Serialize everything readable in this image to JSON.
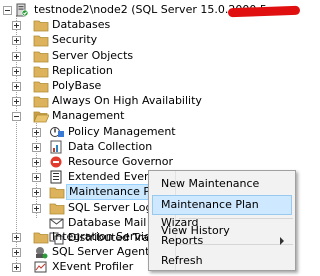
{
  "server": {
    "label": "testnode2\\node2 (SQL Server 15.0.2000.5 - "
  },
  "tree": {
    "items": [
      {
        "label": "Databases"
      },
      {
        "label": "Security"
      },
      {
        "label": "Server Objects"
      },
      {
        "label": "Replication"
      },
      {
        "label": "PolyBase"
      },
      {
        "label": "Always On High Availability"
      },
      {
        "label": "Management"
      },
      {
        "label": "Policy Management"
      },
      {
        "label": "Data Collection"
      },
      {
        "label": "Resource Governor"
      },
      {
        "label": "Extended Events"
      },
      {
        "label": "Maintenance Plans"
      },
      {
        "label": "SQL Server Logs"
      },
      {
        "label": "Database Mail"
      },
      {
        "label": "Distributed Trans"
      },
      {
        "label": "Integration Services C"
      },
      {
        "label": "SQL Server Agent"
      },
      {
        "label": "XEvent Profiler"
      }
    ]
  },
  "context_menu": {
    "items": [
      {
        "label": "New Maintenance Plan..."
      },
      {
        "label": "Maintenance Plan Wizard"
      },
      {
        "label": "View History"
      },
      {
        "label": "Reports"
      },
      {
        "label": "Refresh"
      }
    ]
  },
  "colors": {
    "selection": "#cce8ff",
    "menu_hover": "#cde8ff",
    "folder": "#dcb35c",
    "redaction": "#e01010"
  }
}
